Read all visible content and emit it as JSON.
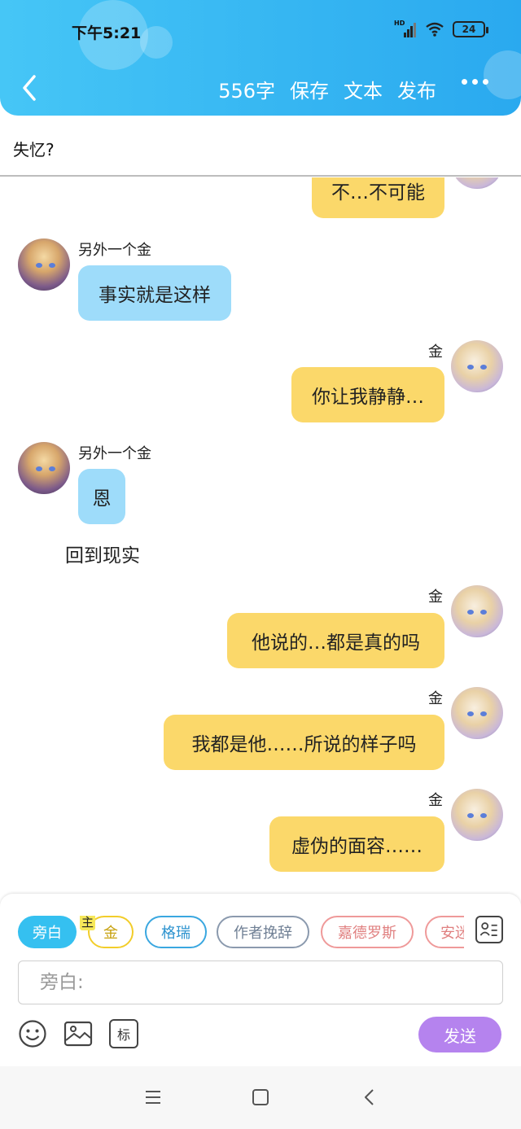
{
  "status": {
    "time": "下午5:21",
    "network": "HD",
    "battery": "24"
  },
  "header": {
    "word_count": "556字",
    "actions": [
      "保存",
      "文本",
      "发布"
    ],
    "icons": {
      "back": "back-arrow-icon",
      "more": "more-dots-icon"
    }
  },
  "story": {
    "title": "失忆?"
  },
  "messages": [
    {
      "side": "right",
      "name": "",
      "text": "不…不可能"
    },
    {
      "side": "left",
      "name": "另外一个金",
      "text": "事实就是这样"
    },
    {
      "side": "right",
      "name": "金",
      "text": "你让我静静…"
    },
    {
      "side": "left",
      "name": "另外一个金",
      "text": "恩"
    },
    {
      "side": "narration",
      "text": "回到现实"
    },
    {
      "side": "right",
      "name": "金",
      "text": "他说的…都是真的吗"
    },
    {
      "side": "right",
      "name": "金",
      "text": "我都是他……所说的样子吗"
    },
    {
      "side": "right",
      "name": "金",
      "text": "虚伪的面容……"
    }
  ],
  "composer": {
    "roles": [
      "旁白",
      "金",
      "格瑞",
      "作者挽辞",
      "嘉德罗斯",
      "安迷"
    ],
    "main_badge": "主",
    "active_role": "旁白",
    "placeholder": "旁白:",
    "send_label": "发送",
    "tool_icons": [
      "emoji-icon",
      "image-icon",
      "tag-icon"
    ],
    "tag_label": "标",
    "colors": {
      "active": "#35c0f0",
      "send": "#b583ee",
      "bubble_right": "#fbd86a",
      "bubble_left": "#9edcfa"
    }
  }
}
